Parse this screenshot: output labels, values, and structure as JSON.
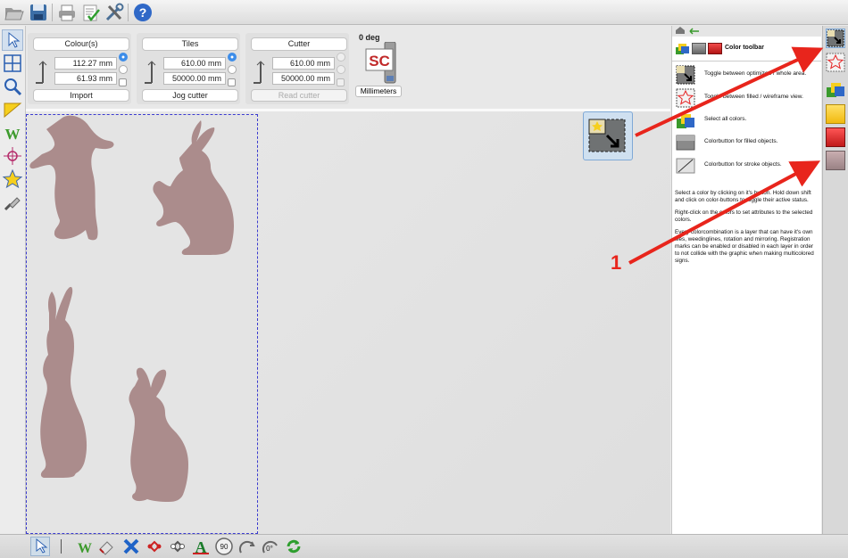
{
  "options": {
    "colours": {
      "title": "Colour(s)",
      "x_value": "112.27 mm",
      "y_value": "61.93 mm",
      "button": "Import"
    },
    "tiles": {
      "title": "Tiles",
      "x_value": "610.00 mm",
      "y_value": "50000.00 mm",
      "button": "Jog cutter"
    },
    "cutter": {
      "title": "Cutter",
      "x_value": "610.00 mm",
      "y_value": "50000.00 mm",
      "button": "Read cutter"
    },
    "rotation_label": "0 deg",
    "units_button": "Millimeters",
    "logo_text": "SC"
  },
  "help_panel": {
    "title": "Color toolbar",
    "rows": [
      {
        "icon": "zoom-area-icon",
        "text": "Toggle between optimized / whole area."
      },
      {
        "icon": "star-outline-icon",
        "text": "Toggle between filled / wireframe view."
      },
      {
        "icon": "select-all-colors-icon",
        "text": "Select all colors."
      },
      {
        "icon": "color-button-filled-icon",
        "text": "Colorbutton for filled objects."
      },
      {
        "icon": "color-button-stroke-icon",
        "text": "Colorbutton for stroke objects."
      }
    ],
    "paragraphs": [
      "Select a color by clicking on it's button. Hold down shift and click on color-buttons to toggle their active status.",
      "Right-click on the colors to set attributes to the selected colors.",
      "Every colorcombination is a layer that can have it's own tiles, weedinglines, rotation and mirroring. Registration marks can be enabled or disabled in each layer in order to not collide with the graphic when making multicolored signs."
    ]
  },
  "annotation": {
    "label": "1",
    "color": "#e8251c"
  },
  "bottom": {
    "rotate_90": "90",
    "rotate_0": "0°"
  },
  "colors": {
    "shape_fill": "#ab8c8c",
    "accent": "#3b3bd0",
    "yellow": "#f6cf1d",
    "red": "#e52324"
  }
}
